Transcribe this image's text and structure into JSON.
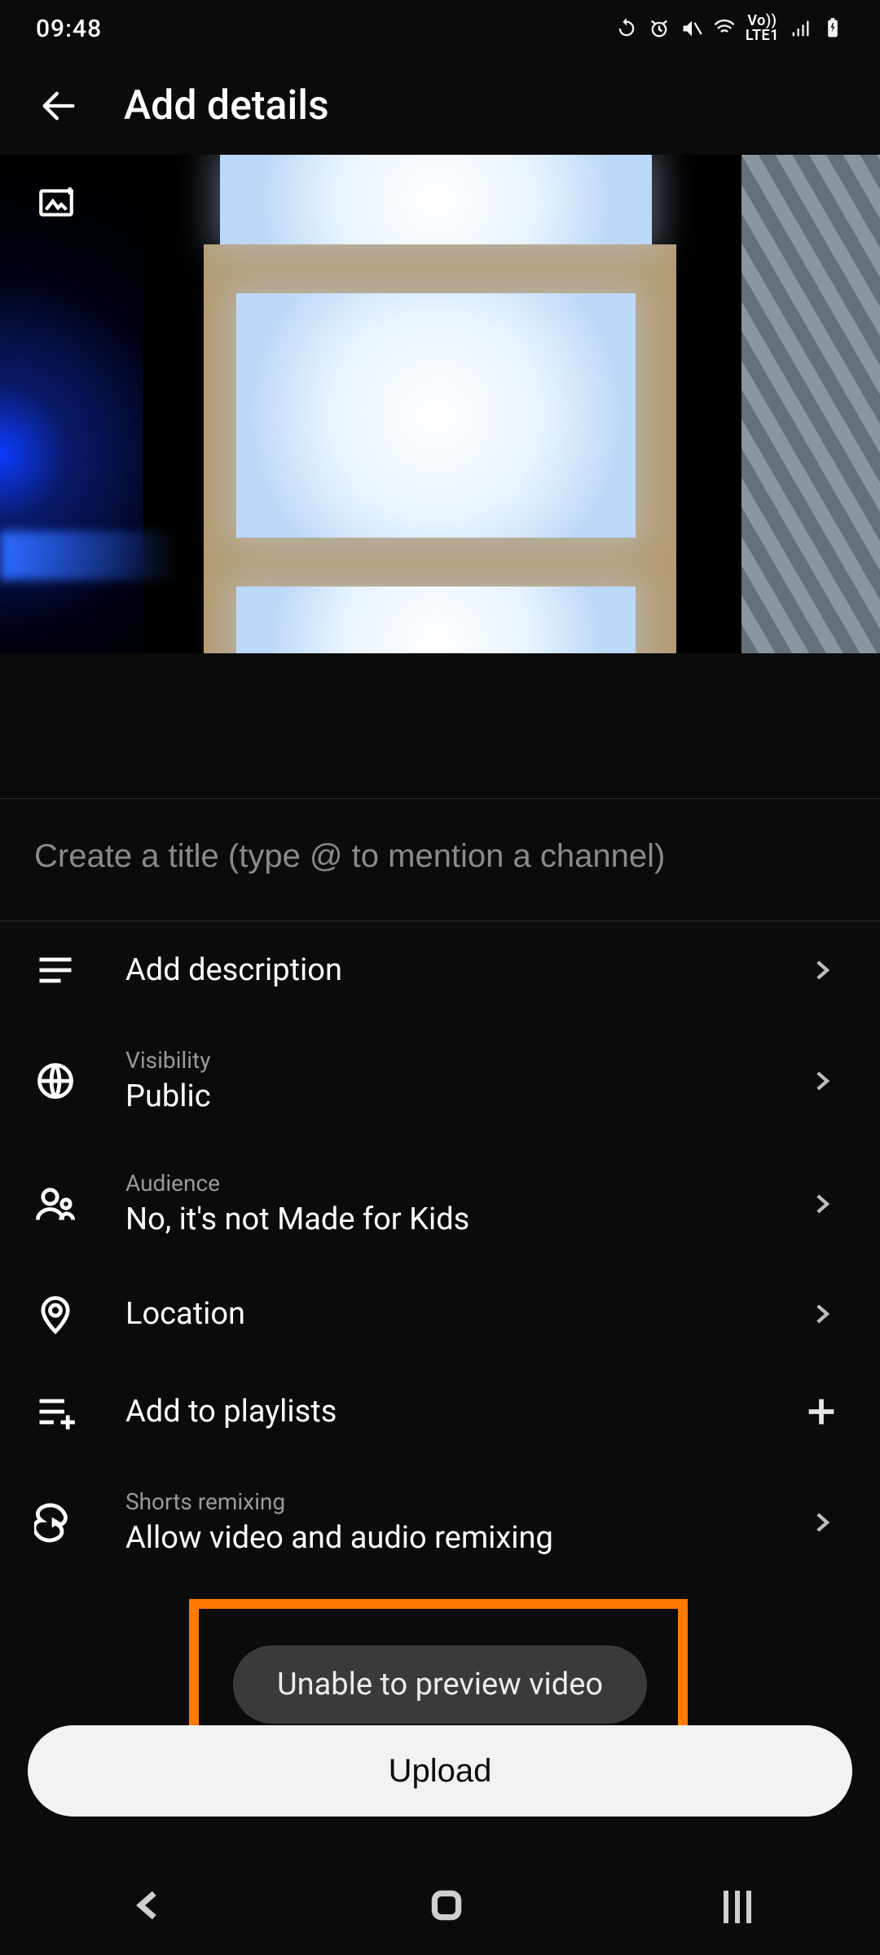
{
  "status_bar": {
    "time": "09:48",
    "volte": "Vo))\nLTE1"
  },
  "header": {
    "title": "Add details"
  },
  "title_field": {
    "placeholder": "Create a title (type @ to mention a channel)",
    "value": ""
  },
  "rows": {
    "description": {
      "label": "Add description"
    },
    "visibility": {
      "label": "Visibility",
      "value": "Public"
    },
    "audience": {
      "label": "Audience",
      "value": "No, it's not Made for Kids"
    },
    "location": {
      "label": "Location"
    },
    "playlists": {
      "label": "Add to playlists"
    },
    "remix": {
      "label": "Shorts remixing",
      "value": "Allow video and audio remixing"
    }
  },
  "toast": {
    "message": "Unable to preview video"
  },
  "upload": {
    "label": "Upload"
  },
  "highlight_color": "#ff7a00"
}
